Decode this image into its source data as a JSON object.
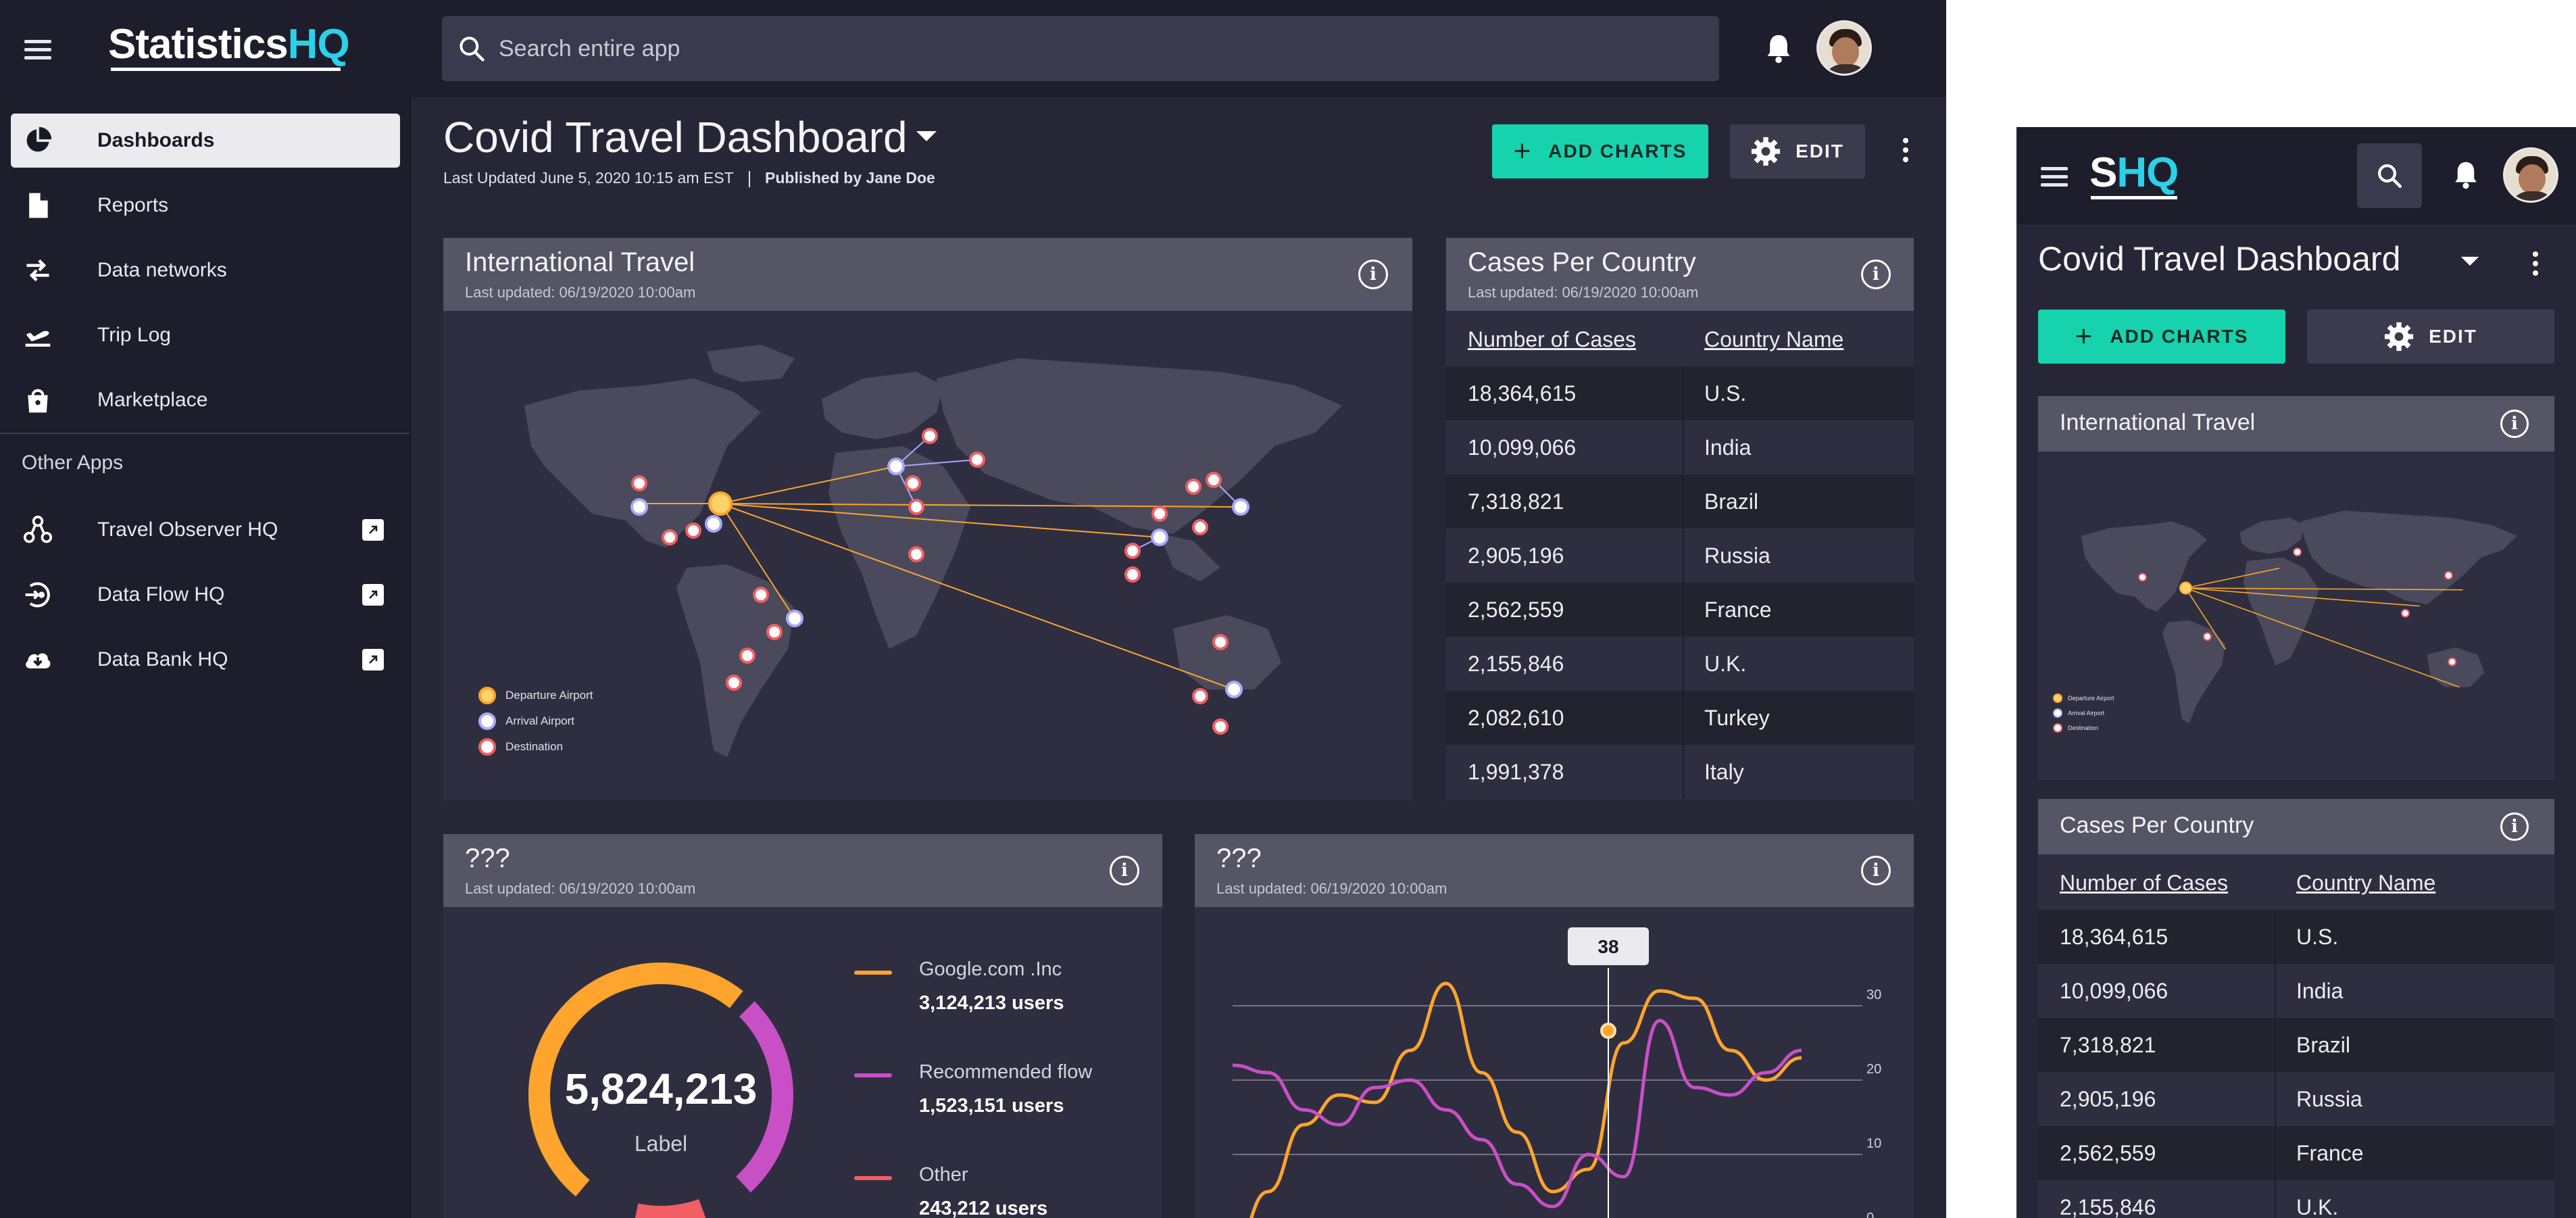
{
  "app": {
    "logo_main": "Statistics",
    "logo_accent": "HQ",
    "logo_short_main": "S",
    "logo_short_accent": "HQ"
  },
  "search": {
    "placeholder": "Search entire app"
  },
  "sidebar": {
    "items": [
      {
        "label": "Dashboards",
        "icon": "pie-chart-icon",
        "active": true
      },
      {
        "label": "Reports",
        "icon": "document-icon"
      },
      {
        "label": "Data networks",
        "icon": "swap-arrows-icon"
      },
      {
        "label": "Trip Log",
        "icon": "airplane-icon"
      },
      {
        "label": "Marketplace",
        "icon": "shopping-bag-icon"
      }
    ],
    "other_apps_heading": "Other Apps",
    "other_apps": [
      {
        "label": "Travel Observer HQ",
        "icon": "network-nodes-icon"
      },
      {
        "label": "Data Flow HQ",
        "icon": "flow-circle-icon"
      },
      {
        "label": "Data Bank HQ",
        "icon": "cloud-download-icon"
      }
    ]
  },
  "page": {
    "title": "Covid Travel Dashboard",
    "last_updated": "Last Updated June 5, 2020 10:15 am EST",
    "published_by": "Published by Jane Doe",
    "add_charts_label": "ADD CHARTS",
    "edit_label": "EDIT"
  },
  "cards": {
    "travel": {
      "title": "International Travel",
      "subtitle": "Last updated: 06/19/2020 10:00am",
      "legend": [
        "Departure Airport",
        "Arrival Airport",
        "Destination"
      ]
    },
    "cases": {
      "title": "Cases Per Country",
      "subtitle": "Last updated: 06/19/2020 10:00am",
      "col1": "Number of Cases",
      "col2": "Country Name",
      "rows": [
        {
          "cases": "18,364,615",
          "country": "U.S."
        },
        {
          "cases": "10,099,066",
          "country": "India"
        },
        {
          "cases": "7,318,821",
          "country": "Brazil"
        },
        {
          "cases": "2,905,196",
          "country": "Russia"
        },
        {
          "cases": "2,562,559",
          "country": "France"
        },
        {
          "cases": "2,155,846",
          "country": "U.K."
        },
        {
          "cases": "2,082,610",
          "country": "Turkey"
        },
        {
          "cases": "1,991,378",
          "country": "Italy"
        }
      ]
    },
    "donut": {
      "title": "???",
      "subtitle": "Last updated: 06/19/2020 10:00am",
      "total": "5,824,213",
      "label": "Label",
      "legend": [
        {
          "name": "Google.com .Inc",
          "value": "3,124,213 users",
          "color": "#ffa42d"
        },
        {
          "name": "Recommended flow",
          "value": "1,523,151 users",
          "color": "#c94fc7"
        },
        {
          "name": "Other",
          "value": "243,212 users",
          "color": "#f25e63"
        }
      ]
    },
    "line": {
      "title": "???",
      "subtitle": "Last updated: 06/19/2020 10:00am",
      "tooltip": "38",
      "y_ticks": [
        "30",
        "20",
        "10",
        "0"
      ]
    }
  },
  "mobile": {
    "title": "Covid Travel Dashboard",
    "add_charts_label": "ADD CHARTS",
    "edit_label": "EDIT",
    "travel_title": "International Travel",
    "cases_title": "Cases Per Country",
    "visible_rows": 6
  },
  "colors": {
    "accent_green": "#16d3ad",
    "accent_cyan": "#2bd0ea",
    "orange": "#ffa42d",
    "purple": "#c94fc7",
    "red": "#f25e63"
  },
  "chart_data": {
    "type": "line",
    "y_ticks": [
      0,
      10,
      20,
      30
    ],
    "ylim": [
      0,
      35
    ],
    "highlight": {
      "label": "38"
    },
    "series": [
      {
        "values": [
          -3,
          5,
          14,
          18,
          17,
          24,
          33,
          21,
          13,
          5,
          8,
          25,
          32,
          31,
          24,
          20,
          23
        ]
      },
      {
        "values": [
          22,
          21,
          16,
          14,
          19,
          20,
          16,
          12,
          6,
          3,
          10,
          7,
          28,
          19,
          18,
          21,
          24
        ]
      }
    ]
  }
}
